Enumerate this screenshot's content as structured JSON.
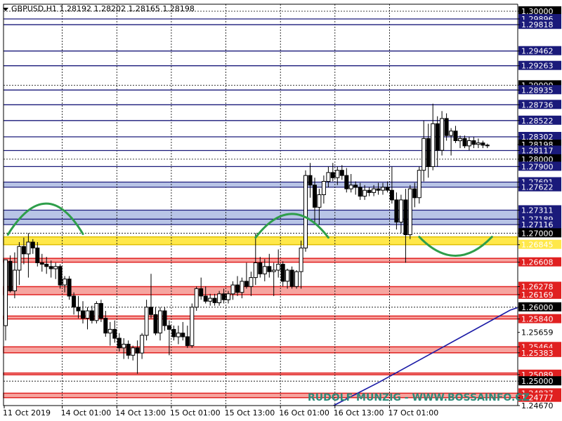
{
  "chart_data": {
    "type": "candlestick",
    "title": "GBPUSD,H1  1.28192 1.28202 1.28165 1.28198",
    "symbol": "GBPUSD",
    "timeframe": "H1",
    "ohlc_header": {
      "open": 1.28192,
      "high": 1.28202,
      "low": 1.28165,
      "close": 1.28198
    },
    "ylim": [
      1.2467,
      1.3
    ],
    "grid": "dotted",
    "x_ticks": [
      "11 Oct 2019",
      "14 Oct 01:00",
      "14 Oct 13:00",
      "15 Oct 01:00",
      "15 Oct 13:00",
      "16 Oct 01:00",
      "16 Oct 13:00",
      "17 Oct 01:00"
    ],
    "grid_levels": [
      1.3,
      1.29,
      1.28,
      1.27,
      1.26,
      1.25
    ],
    "price_labels": [
      "1.30000",
      "1.29896",
      "1.29818",
      "1.29462",
      "1.29263",
      "1.29000",
      "1.28935",
      "1.28736",
      "1.28522",
      "1.28302",
      "1.28198",
      "1.28117",
      "1.28000",
      "1.27900",
      "1.27691",
      "1.27622",
      "1.27311",
      "1.27189",
      "1.27116",
      "1.27000",
      "1.26845",
      "1.26608",
      "1.26278",
      "1.26169",
      "1.26000",
      "1.25840",
      "1.25659",
      "1.25464",
      "1.25383",
      "1.25089",
      "1.25000",
      "1.24837",
      "1.24777",
      "1.24670"
    ],
    "current_price": "1.28198",
    "levels": {
      "resistance_lines": [
        1.29896,
        1.29818,
        1.29462,
        1.29263,
        1.28935,
        1.28736,
        1.28522,
        1.28302,
        1.28117,
        1.279
      ],
      "blue_zones": [
        [
          1.27622,
          1.27691
        ],
        [
          1.27311,
          1.27189
        ],
        [
          1.27116,
          1.27189
        ]
      ],
      "yellow_zone": [
        1.26845,
        1.2695
      ],
      "red_zones": [
        [
          1.26608,
          1.2666
        ],
        [
          1.26169,
          1.26278
        ],
        [
          1.2584,
          1.2588
        ],
        [
          1.25383,
          1.25464
        ],
        [
          1.25089,
          1.2511
        ],
        [
          1.24777,
          1.24837
        ]
      ]
    },
    "moving_average": [
      [
        0,
        1.2354
      ],
      [
        55,
        1.2413
      ],
      [
        82,
        1.2498
      ],
      [
        111,
        1.2596
      ],
      [
        128,
        1.2631
      ]
    ],
    "arcs": [
      {
        "shape": "hump",
        "start": [
          0.5,
          1.2698
        ],
        "peak": [
          9,
          1.274
        ],
        "end": [
          17,
          1.2699
        ]
      },
      {
        "shape": "hump",
        "start": [
          55,
          1.2694
        ],
        "peak": [
          63,
          1.2726
        ],
        "end": [
          71,
          1.2694
        ]
      },
      {
        "shape": "cup",
        "start": [
          91,
          1.2695
        ],
        "bottom": [
          99,
          1.26695
        ],
        "end": [
          107,
          1.2695
        ]
      }
    ],
    "candles": [
      [
        1.2575,
        1.2662,
        1.2555,
        1.2664
      ],
      [
        1.2662,
        1.267,
        1.262,
        1.2622
      ],
      [
        1.2622,
        1.2674,
        1.2612,
        1.265
      ],
      [
        1.265,
        1.2688,
        1.263,
        1.2682
      ],
      [
        1.2682,
        1.2694,
        1.2658,
        1.2672
      ],
      [
        1.2672,
        1.27,
        1.264,
        1.2688
      ],
      [
        1.2688,
        1.2692,
        1.2672,
        1.268
      ],
      [
        1.268,
        1.2688,
        1.2655,
        1.266
      ],
      [
        1.266,
        1.2672,
        1.2648,
        1.2658
      ],
      [
        1.2658,
        1.2668,
        1.2645,
        1.2655
      ],
      [
        1.2655,
        1.2663,
        1.264,
        1.2652
      ],
      [
        1.2652,
        1.266,
        1.2638,
        1.2655
      ],
      [
        1.2655,
        1.2658,
        1.2625,
        1.263
      ],
      [
        1.263,
        1.2642,
        1.262,
        1.2638
      ],
      [
        1.2638,
        1.2642,
        1.261,
        1.2615
      ],
      [
        1.2615,
        1.262,
        1.259,
        1.26
      ],
      [
        1.26,
        1.2615,
        1.2585,
        1.2595
      ],
      [
        1.2595,
        1.2608,
        1.2578,
        1.2585
      ],
      [
        1.2585,
        1.26,
        1.257,
        1.2595
      ],
      [
        1.2595,
        1.2602,
        1.2578,
        1.2582
      ],
      [
        1.2582,
        1.2608,
        1.2578,
        1.2605
      ],
      [
        1.2605,
        1.261,
        1.258,
        1.2585
      ],
      [
        1.2585,
        1.2595,
        1.256,
        1.2565
      ],
      [
        1.2565,
        1.258,
        1.2548,
        1.257
      ],
      [
        1.257,
        1.2582,
        1.2552,
        1.2558
      ],
      [
        1.2558,
        1.2565,
        1.254,
        1.2545
      ],
      [
        1.2545,
        1.2558,
        1.253,
        1.255
      ],
      [
        1.255,
        1.2555,
        1.253,
        1.2535
      ],
      [
        1.2535,
        1.2548,
        1.2528,
        1.2545
      ],
      [
        1.2545,
        1.2555,
        1.251,
        1.2538
      ],
      [
        1.2538,
        1.2565,
        1.253,
        1.2562
      ],
      [
        1.2562,
        1.261,
        1.2555,
        1.26
      ],
      [
        1.26,
        1.2645,
        1.2585,
        1.259
      ],
      [
        1.259,
        1.26,
        1.2562,
        1.2565
      ],
      [
        1.2565,
        1.26,
        1.2555,
        1.2595
      ],
      [
        1.2595,
        1.26,
        1.2568,
        1.2575
      ],
      [
        1.2575,
        1.2582,
        1.2535,
        1.257
      ],
      [
        1.257,
        1.2575,
        1.2555,
        1.256
      ],
      [
        1.256,
        1.2575,
        1.255,
        1.2565
      ],
      [
        1.2565,
        1.258,
        1.2555,
        1.256
      ],
      [
        1.256,
        1.2575,
        1.2545,
        1.2548
      ],
      [
        1.2548,
        1.2605,
        1.2545,
        1.26
      ],
      [
        1.26,
        1.2628,
        1.2595,
        1.2625
      ],
      [
        1.2625,
        1.264,
        1.261,
        1.2615
      ],
      [
        1.2615,
        1.2628,
        1.2605,
        1.2608
      ],
      [
        1.2608,
        1.2618,
        1.2602,
        1.2612
      ],
      [
        1.2612,
        1.2618,
        1.2602,
        1.2606
      ],
      [
        1.2606,
        1.2622,
        1.2602,
        1.2618
      ],
      [
        1.2618,
        1.2625,
        1.2605,
        1.261
      ],
      [
        1.261,
        1.2622,
        1.2605,
        1.2618
      ],
      [
        1.2618,
        1.2635,
        1.261,
        1.263
      ],
      [
        1.263,
        1.2642,
        1.2615,
        1.262
      ],
      [
        1.262,
        1.264,
        1.2612,
        1.2635
      ],
      [
        1.2635,
        1.266,
        1.2625,
        1.2628
      ],
      [
        1.2628,
        1.2648,
        1.2615,
        1.264
      ],
      [
        1.264,
        1.27,
        1.263,
        1.266
      ],
      [
        1.266,
        1.2668,
        1.264,
        1.2645
      ],
      [
        1.2645,
        1.2665,
        1.2635,
        1.2655
      ],
      [
        1.2655,
        1.2672,
        1.264,
        1.2648
      ],
      [
        1.2648,
        1.266,
        1.2615,
        1.265
      ],
      [
        1.265,
        1.2678,
        1.264,
        1.2658
      ],
      [
        1.2658,
        1.2662,
        1.2628,
        1.2635
      ],
      [
        1.2635,
        1.2652,
        1.2625,
        1.265
      ],
      [
        1.265,
        1.2655,
        1.2625,
        1.2628
      ],
      [
        1.2628,
        1.265,
        1.2625,
        1.2648
      ],
      [
        1.2648,
        1.269,
        1.2625,
        1.268
      ],
      [
        1.268,
        1.2785,
        1.2675,
        1.2778
      ],
      [
        1.2778,
        1.2795,
        1.2748,
        1.2765
      ],
      [
        1.2765,
        1.2775,
        1.2715,
        1.2735
      ],
      [
        1.2735,
        1.276,
        1.2712,
        1.2752
      ],
      [
        1.2752,
        1.2778,
        1.274,
        1.277
      ],
      [
        1.277,
        1.279,
        1.2762,
        1.2782
      ],
      [
        1.2782,
        1.2795,
        1.277,
        1.2775
      ],
      [
        1.2775,
        1.279,
        1.2765,
        1.2785
      ],
      [
        1.2785,
        1.2792,
        1.2772,
        1.2778
      ],
      [
        1.2778,
        1.2788,
        1.2755,
        1.276
      ],
      [
        1.276,
        1.278,
        1.2755,
        1.2765
      ],
      [
        1.2765,
        1.277,
        1.2752,
        1.2762
      ],
      [
        1.2762,
        1.2768,
        1.2745,
        1.275
      ],
      [
        1.275,
        1.2765,
        1.2745,
        1.2758
      ],
      [
        1.2758,
        1.2762,
        1.275,
        1.2755
      ],
      [
        1.2755,
        1.2765,
        1.275,
        1.276
      ],
      [
        1.276,
        1.2768,
        1.2752,
        1.2758
      ],
      [
        1.2758,
        1.2768,
        1.2752,
        1.2762
      ],
      [
        1.2762,
        1.277,
        1.2755,
        1.2758
      ],
      [
        1.2758,
        1.279,
        1.274,
        1.2745
      ],
      [
        1.2745,
        1.2755,
        1.2705,
        1.2715
      ],
      [
        1.2715,
        1.2752,
        1.27,
        1.2745
      ],
      [
        1.2745,
        1.276,
        1.266,
        1.2698
      ],
      [
        1.2698,
        1.2765,
        1.2692,
        1.276
      ],
      [
        1.276,
        1.2768,
        1.2735,
        1.2748
      ],
      [
        1.2748,
        1.279,
        1.274,
        1.2785
      ],
      [
        1.2785,
        1.2852,
        1.277,
        1.2828
      ],
      [
        1.2828,
        1.2848,
        1.2775,
        1.279
      ],
      [
        1.279,
        1.2875,
        1.2785,
        1.2848
      ],
      [
        1.2848,
        1.2858,
        1.279,
        1.2812
      ],
      [
        1.2812,
        1.2865,
        1.2805,
        1.2855
      ],
      [
        1.2855,
        1.2862,
        1.2825,
        1.2832
      ],
      [
        1.2832,
        1.2842,
        1.2805,
        1.2838
      ],
      [
        1.2838,
        1.2845,
        1.2822,
        1.2825
      ],
      [
        1.2825,
        1.2832,
        1.2815,
        1.2828
      ],
      [
        1.2828,
        1.2832,
        1.2815,
        1.2818
      ],
      [
        1.2818,
        1.283,
        1.2812,
        1.2825
      ],
      [
        1.2825,
        1.283,
        1.2815,
        1.282
      ],
      [
        1.282,
        1.2828,
        1.2815,
        1.2822
      ],
      [
        1.2822,
        1.2825,
        1.2815,
        1.2819
      ],
      [
        1.2819,
        1.2821,
        1.2815,
        1.2819
      ]
    ]
  },
  "watermark": "RUDOLF MUNZIG - WWW.BOSSAINFO.CZ",
  "colors": {
    "background": "#ffffff",
    "grid": "#000000",
    "candle": "#000000",
    "resistance_line": "#1a1a7a",
    "blue_zone_fill": "#b8c4e6",
    "blue_zone_border": "#1a1a7a",
    "yellow_zone_fill": "#ffe84a",
    "yellow_zone_border": "#e0c000",
    "red_zone_fill": "#f6a5a0",
    "red_zone_border": "#e02020",
    "moving_average": "#1a1aa6",
    "arc": "#2e9e4a",
    "watermark": "#2e8b7a",
    "current_price_box": "#000000",
    "price_box_dark": "#1a1a7a"
  },
  "icons": {
    "title_marker": "triangle-down-icon"
  }
}
